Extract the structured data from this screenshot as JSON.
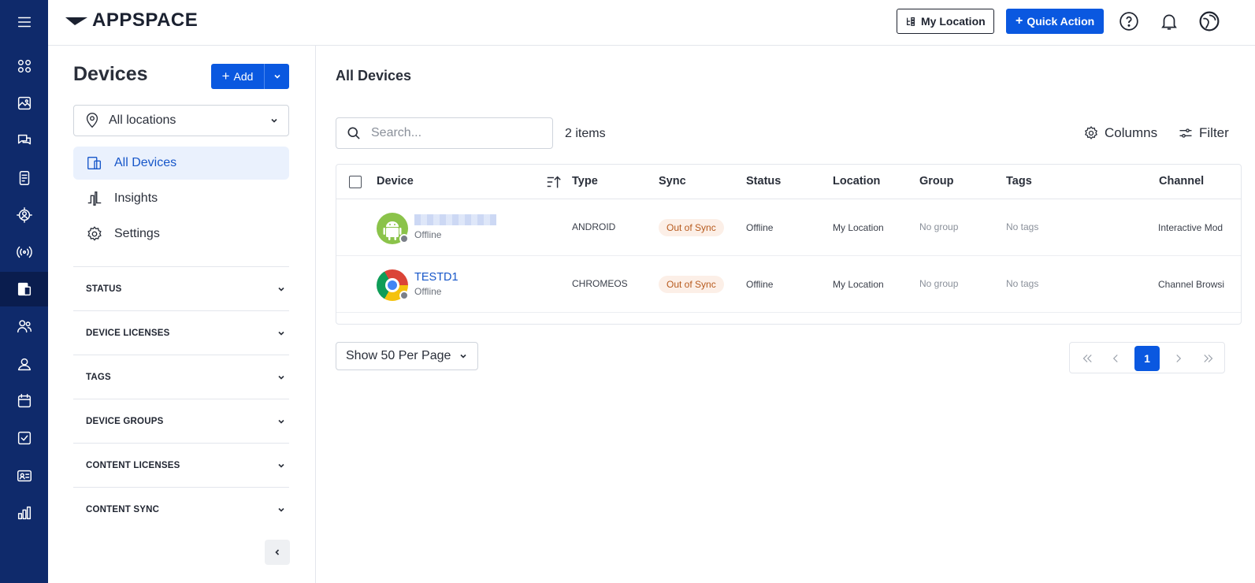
{
  "brand": {
    "name": "APPSPACE"
  },
  "topbar": {
    "my_location_label": "My Location",
    "quick_action_label": "Quick Action"
  },
  "rail": {
    "icons": [
      "menu-icon",
      "dashboard-icon",
      "library-icon",
      "messages-icon",
      "documents-icon",
      "places-icon",
      "broadcast-icon",
      "devices-icon",
      "users-icon",
      "profile-icon",
      "calendar-icon",
      "tasks-icon",
      "id-card-icon",
      "analytics-icon"
    ],
    "active": "devices-icon"
  },
  "sidebar": {
    "title": "Devices",
    "add_label": "Add",
    "location_select": "All locations",
    "nav": [
      {
        "label": "All Devices",
        "icon": "devices-icon",
        "active": true
      },
      {
        "label": "Insights",
        "icon": "insights-icon",
        "active": false
      },
      {
        "label": "Settings",
        "icon": "gear-icon",
        "active": false
      }
    ],
    "filters": [
      "STATUS",
      "DEVICE LICENSES",
      "TAGS",
      "DEVICE GROUPS",
      "CONTENT LICENSES",
      "CONTENT SYNC"
    ]
  },
  "main": {
    "title": "All Devices",
    "search_placeholder": "Search...",
    "item_count": "2 items",
    "columns_label": "Columns",
    "filter_label": "Filter",
    "per_page_label": "Show 50 Per Page",
    "current_page": "1"
  },
  "table": {
    "headers": [
      "Device",
      "Type",
      "Sync",
      "Status",
      "Location",
      "Group",
      "Tags",
      "Channel"
    ],
    "rows": [
      {
        "name": "",
        "name_redacted": true,
        "sub": "Offline",
        "type": "ANDROID",
        "sync": "Out of Sync",
        "status": "Offline",
        "location": "My Location",
        "group": "No group",
        "tags": "No tags",
        "channel": "Interactive Mod",
        "icon": "android-icon"
      },
      {
        "name": "TESTD1",
        "name_redacted": false,
        "sub": "Offline",
        "type": "CHROMEOS",
        "sync": "Out of Sync",
        "status": "Offline",
        "location": "My Location",
        "group": "No group",
        "tags": "No tags",
        "channel": "Channel Browsi",
        "icon": "chrome-icon"
      }
    ]
  },
  "colors": {
    "rail_bg": "#0f2a6b",
    "primary": "#0a58e0",
    "link": "#1656c9",
    "sync_badge_bg": "#fcefe7",
    "sync_badge_text": "#b75a1d",
    "android": "#8bc34a"
  }
}
